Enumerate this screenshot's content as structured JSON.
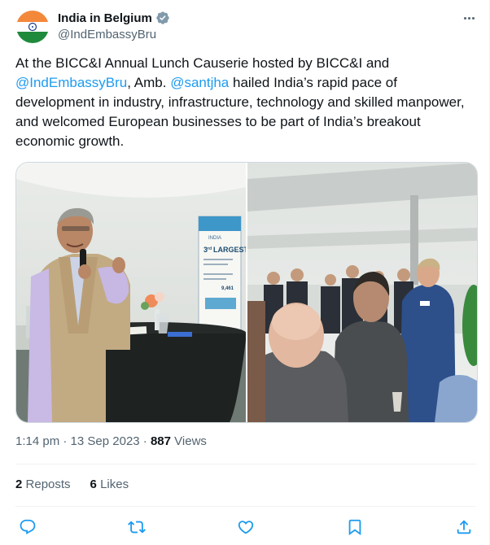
{
  "account": {
    "display_name": "India in Belgium",
    "handle": "@IndEmbassyBru",
    "verified_icon": "verified-badge-icon"
  },
  "tweet": {
    "text_part1": "At the BICC&I Annual Lunch Causerie hosted by BICC&I and ",
    "mention1": "@IndEmbassyBru",
    "text_part2": ", Amb. ",
    "mention2": "@santjha",
    "text_part3": " hailed India’s rapid pace of development in industry, infrastructure, technology and skilled manpower, and welcomed European businesses to be part of India’s breakout economic growth."
  },
  "banner": {
    "line1": "INDIA",
    "line2": "3",
    "line2_suffix": "rd",
    "line3": "LARGEST",
    "number": "9,461"
  },
  "meta": {
    "time": "1:14 pm",
    "separator": "·",
    "date": "13 Sep 2023",
    "views_count": "887",
    "views_label": "Views"
  },
  "stats": {
    "reposts_count": "2",
    "reposts_label": "Reposts",
    "likes_count": "6",
    "likes_label": "Likes"
  },
  "colors": {
    "accent": "#1d9bf0",
    "secondary_text": "#536471",
    "border": "#eff3f4"
  }
}
